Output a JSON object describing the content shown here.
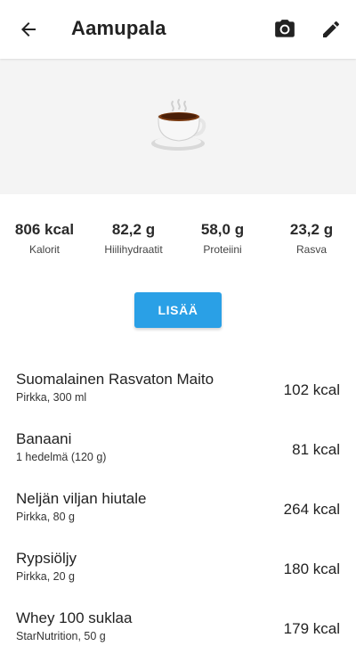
{
  "header": {
    "title": "Aamupala",
    "back_icon": "arrow-back-icon",
    "camera_icon": "camera-icon",
    "edit_icon": "pencil-icon"
  },
  "hero": {
    "icon": "coffee-cup-icon"
  },
  "totals": [
    {
      "value": "806 kcal",
      "label": "Kalorit"
    },
    {
      "value": "82,2 g",
      "label": "Hiilihydraatit"
    },
    {
      "value": "58,0 g",
      "label": "Proteiini"
    },
    {
      "value": "23,2 g",
      "label": "Rasva"
    }
  ],
  "add_button": {
    "label": "LISÄÄ",
    "color": "#2aa0e6"
  },
  "items": [
    {
      "name": "Suomalainen Rasvaton Maito",
      "detail": "Pirkka, 300 ml",
      "kcal": "102 kcal"
    },
    {
      "name": "Banaani",
      "detail": "1 hedelmä (120 g)",
      "kcal": "81 kcal"
    },
    {
      "name": "Neljän viljan hiutale",
      "detail": "Pirkka, 80 g",
      "kcal": "264 kcal"
    },
    {
      "name": "Rypsiöljy",
      "detail": "Pirkka, 20 g",
      "kcal": "180 kcal"
    },
    {
      "name": "Whey 100 suklaa",
      "detail": "StarNutrition, 50 g",
      "kcal": "179 kcal"
    }
  ]
}
